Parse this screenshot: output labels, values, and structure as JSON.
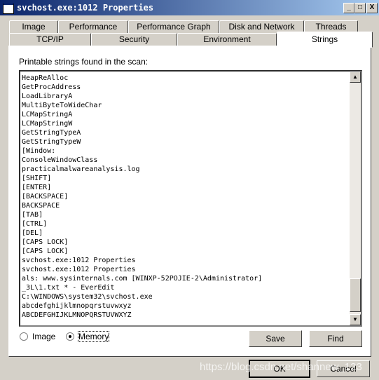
{
  "window": {
    "title": "svchost.exe:1012 Properties",
    "minimize": "_",
    "maximize": "□",
    "close": "X"
  },
  "tabs_row1": [
    "Image",
    "Performance",
    "Performance Graph",
    "Disk and Network",
    "Threads"
  ],
  "tabs_row2": [
    "TCP/IP",
    "Security",
    "Environment",
    "Strings"
  ],
  "active_tab": "Strings",
  "panel": {
    "label": "Printable strings found in the scan:",
    "strings": [
      "HeapReAlloc",
      "GetProcAddress",
      "LoadLibraryA",
      "MultiByteToWideChar",
      "LCMapStringA",
      "LCMapStringW",
      "GetStringTypeA",
      "GetStringTypeW",
      "[Window:",
      "ConsoleWindowClass",
      "practicalmalwareanalysis.log",
      "[SHIFT]",
      "[ENTER]",
      "[BACKSPACE]",
      "BACKSPACE",
      "[TAB]",
      "[CTRL]",
      "[DEL]",
      "[CAPS LOCK]",
      "[CAPS LOCK]",
      "svchost.exe:1012 Properties",
      "svchost.exe:1012 Properties",
      "als: www.sysinternals.com [WINXP-52POJIE-2\\Administrator]",
      "_3L\\1.txt * - EverEdit",
      "C:\\WINDOWS\\system32\\svchost.exe",
      "abcdefghijklmnopqrstuvwxyz",
      "ABCDEFGHIJKLMNOPQRSTUVWXYZ"
    ],
    "radio_image": "Image",
    "radio_memory": "Memory",
    "selected": "Memory",
    "save": "Save",
    "find": "Find"
  },
  "footer": {
    "ok": "OK",
    "cancel": "Cancel"
  },
  "watermark": "https://blog.csdn.net/shannew_123"
}
